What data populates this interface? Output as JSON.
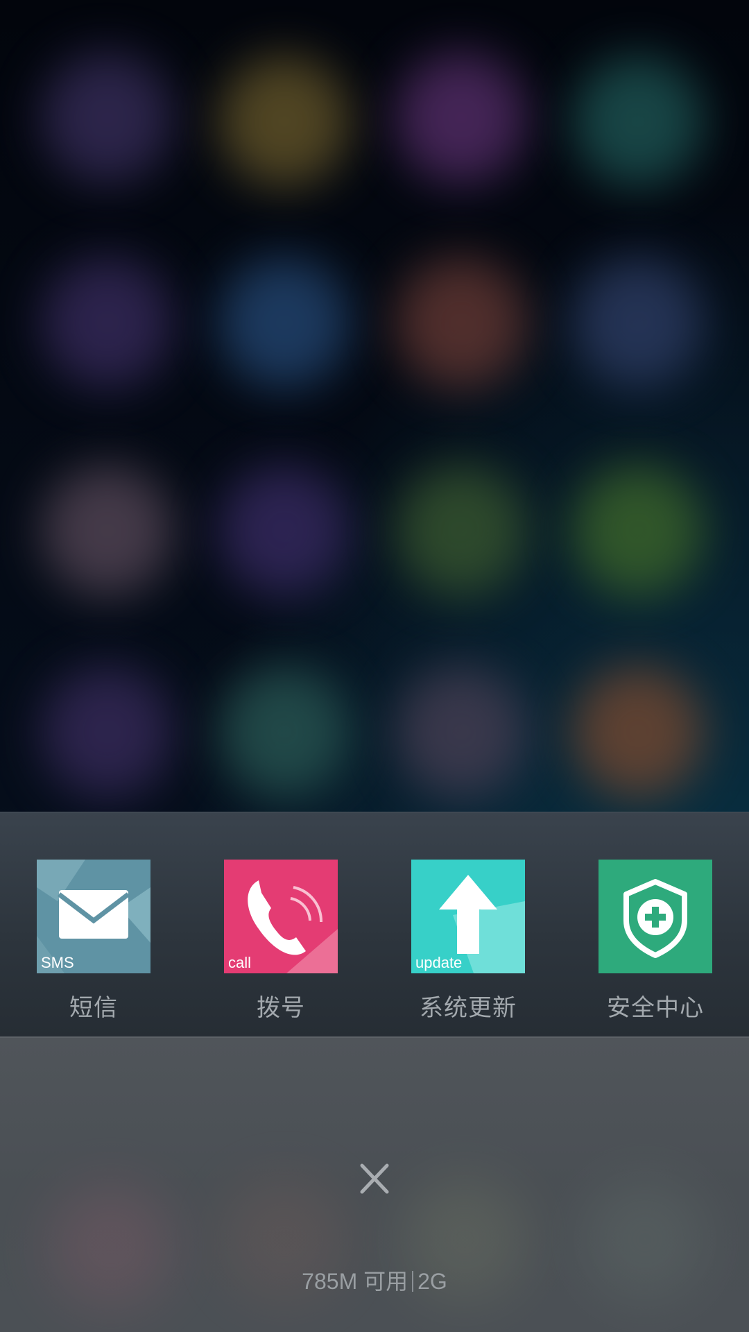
{
  "recent_apps": [
    {
      "name": "短信",
      "badge": "SMS",
      "icon": "sms-envelope-icon",
      "color": "#5f93a4"
    },
    {
      "name": "拨号",
      "badge": "call",
      "icon": "phone-call-icon",
      "color": "#e43c73"
    },
    {
      "name": "系统更新",
      "badge": "update",
      "icon": "update-arrow-icon",
      "color": "#37d0c8"
    },
    {
      "name": "安全中心",
      "badge": "",
      "icon": "shield-plus-icon",
      "color": "#2eaa7c"
    }
  ],
  "clear_button": {
    "icon": "close-icon"
  },
  "memory": {
    "available": "785M 可用",
    "total": "2G"
  }
}
